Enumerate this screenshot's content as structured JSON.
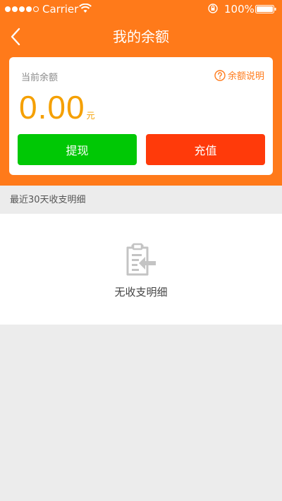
{
  "status_bar": {
    "carrier": "Carrier",
    "battery": "100%",
    "icons": [
      "wifi-icon",
      "lock-icon",
      "battery-icon"
    ]
  },
  "header": {
    "title": "我的余额",
    "back_icon": "chevron-left-icon"
  },
  "balance_card": {
    "label": "当前余额",
    "help_link": "余额说明",
    "help_icon": "question-circle-icon",
    "amount": "0.00",
    "unit": "元",
    "withdraw_button": "提现",
    "recharge_button": "充值"
  },
  "transactions": {
    "section_title": "最近30天收支明细",
    "empty_text": "无收支明细",
    "empty_icon": "clipboard-arrow-icon"
  },
  "colors": {
    "header_orange": "#ff7a1a",
    "amount_orange": "#f5a000",
    "withdraw_green": "#00c805",
    "recharge_red": "#ff3a0a",
    "background_gray": "#ececec"
  }
}
